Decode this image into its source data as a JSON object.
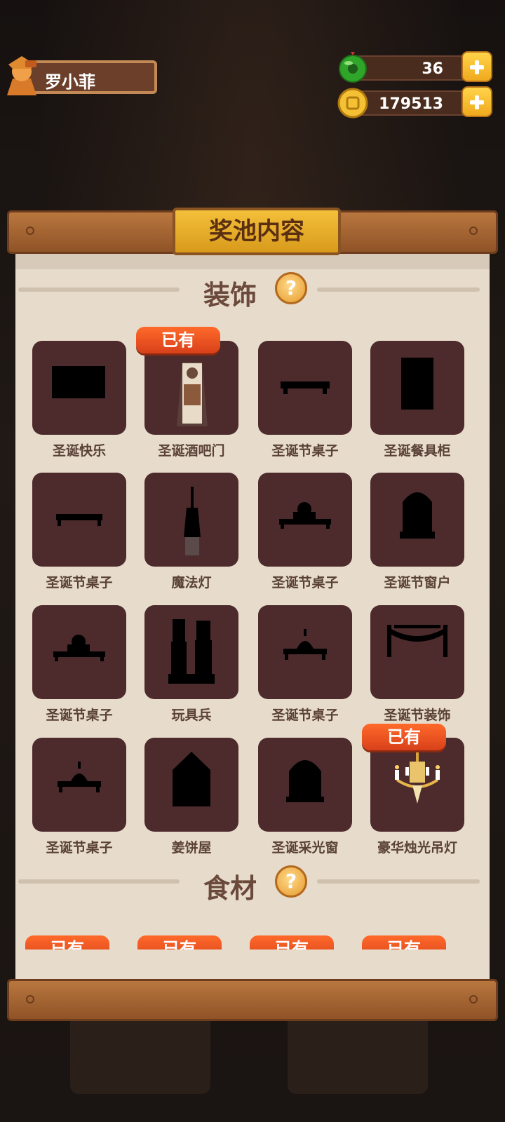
{
  "player": {
    "name": "罗小菲"
  },
  "currency": {
    "gems": "36",
    "coins": "179513"
  },
  "panel": {
    "title": "奖池内容",
    "sections": [
      {
        "title": "装饰",
        "help": "?"
      },
      {
        "title": "食材",
        "help": "?"
      }
    ],
    "owned_label": "已有",
    "decor_items": [
      {
        "label": "圣诞快乐",
        "owned": false,
        "icon": "rectangle-silhouette"
      },
      {
        "label": "圣诞酒吧门",
        "owned": true,
        "icon": "bar-door"
      },
      {
        "label": "圣诞节桌子",
        "owned": false,
        "icon": "table-silhouette"
      },
      {
        "label": "圣诞餐具柜",
        "owned": false,
        "icon": "cabinet-silhouette"
      },
      {
        "label": "圣诞节桌子",
        "owned": false,
        "icon": "table-silhouette"
      },
      {
        "label": "魔法灯",
        "owned": false,
        "icon": "lamp-silhouette"
      },
      {
        "label": "圣诞节桌子",
        "owned": false,
        "icon": "table-with-item-silhouette"
      },
      {
        "label": "圣诞节窗户",
        "owned": false,
        "icon": "window-silhouette"
      },
      {
        "label": "圣诞节桌子",
        "owned": false,
        "icon": "table-with-item-silhouette"
      },
      {
        "label": "玩具兵",
        "owned": false,
        "icon": "toy-soldier-silhouette"
      },
      {
        "label": "圣诞节桌子",
        "owned": false,
        "icon": "table-with-item-silhouette"
      },
      {
        "label": "圣诞节装饰",
        "owned": false,
        "icon": "garland-silhouette"
      },
      {
        "label": "圣诞节桌子",
        "owned": false,
        "icon": "table-with-item-silhouette"
      },
      {
        "label": "姜饼屋",
        "owned": false,
        "icon": "gingerbread-house-silhouette"
      },
      {
        "label": "圣诞采光窗",
        "owned": false,
        "icon": "arched-window-silhouette"
      },
      {
        "label": "豪华烛光吊灯",
        "owned": true,
        "icon": "chandelier"
      }
    ],
    "food_badges": [
      "已有",
      "已有",
      "已有",
      "已有"
    ]
  },
  "colors": {
    "accent": "#f0a91d",
    "badge": "#e24a1c",
    "tile": "#4d2b2c",
    "paper": "#e7dbcb"
  }
}
